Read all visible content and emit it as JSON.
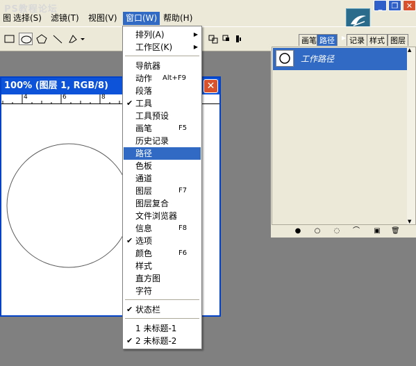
{
  "watermark": "PS教程论坛",
  "menubar": {
    "items": [
      {
        "label": "窗口(W)",
        "active": true
      },
      {
        "label": "帮助(H)",
        "active": false
      },
      {
        "label": "视图(V)",
        "active": false
      },
      {
        "label": "滤镜(T)",
        "active": false
      },
      {
        "label": "选择(S)",
        "active": false
      },
      {
        "label": "图"
      }
    ]
  },
  "document": {
    "title": "100% (图层 1, RGB/8)",
    "ruler_ticks": [
      "4",
      "6",
      "8"
    ]
  },
  "window_menu": {
    "items": [
      {
        "label": "排列(A)",
        "shortcut": "",
        "checked": false,
        "submenu": true,
        "highlighted": false
      },
      {
        "label": "工作区(K)",
        "shortcut": "",
        "checked": false,
        "submenu": true,
        "highlighted": false
      },
      {
        "label": "导航器",
        "shortcut": "",
        "checked": false,
        "submenu": false,
        "highlighted": false
      },
      {
        "label": "动作",
        "shortcut": "Alt+F9",
        "checked": false,
        "submenu": false,
        "highlighted": false
      },
      {
        "label": "段落",
        "shortcut": "",
        "checked": false,
        "submenu": false,
        "highlighted": false
      },
      {
        "label": "工具",
        "shortcut": "",
        "checked": true,
        "submenu": false,
        "highlighted": false
      },
      {
        "label": "工具预设",
        "shortcut": "",
        "checked": false,
        "submenu": false,
        "highlighted": false
      },
      {
        "label": "画笔",
        "shortcut": "F5",
        "checked": false,
        "submenu": false,
        "highlighted": false
      },
      {
        "label": "历史记录",
        "shortcut": "",
        "checked": false,
        "submenu": false,
        "highlighted": false
      },
      {
        "label": "路径",
        "shortcut": "",
        "checked": false,
        "submenu": false,
        "highlighted": true
      },
      {
        "label": "色板",
        "shortcut": "",
        "checked": false,
        "submenu": false,
        "highlighted": false
      },
      {
        "label": "通道",
        "shortcut": "",
        "checked": false,
        "submenu": false,
        "highlighted": false
      },
      {
        "label": "图层",
        "shortcut": "F7",
        "checked": false,
        "submenu": false,
        "highlighted": false
      },
      {
        "label": "图层复合",
        "shortcut": "",
        "checked": false,
        "submenu": false,
        "highlighted": false
      },
      {
        "label": "文件浏览器",
        "shortcut": "",
        "checked": false,
        "submenu": false,
        "highlighted": false
      },
      {
        "label": "信息",
        "shortcut": "F8",
        "checked": false,
        "submenu": false,
        "highlighted": false
      },
      {
        "label": "选项",
        "shortcut": "",
        "checked": true,
        "submenu": false,
        "highlighted": false
      },
      {
        "label": "颜色",
        "shortcut": "F6",
        "checked": false,
        "submenu": false,
        "highlighted": false
      },
      {
        "label": "样式",
        "shortcut": "",
        "checked": false,
        "submenu": false,
        "highlighted": false
      },
      {
        "label": "直方图",
        "shortcut": "",
        "checked": false,
        "submenu": false,
        "highlighted": false
      },
      {
        "label": "字符",
        "shortcut": "",
        "checked": false,
        "submenu": false,
        "highlighted": false
      },
      {
        "label": "状态栏",
        "shortcut": "",
        "checked": true,
        "submenu": false,
        "highlighted": false
      },
      {
        "label": "1 未标题-1",
        "shortcut": "",
        "checked": false,
        "submenu": false,
        "highlighted": false
      },
      {
        "label": "2 未标题-2",
        "shortcut": "",
        "checked": true,
        "submenu": false,
        "highlighted": false
      }
    ]
  },
  "paths_palette": {
    "tabs": [
      "画笔",
      "路径",
      "记录",
      "样式",
      "图层"
    ],
    "active_tab": "路径",
    "rows": [
      {
        "name": "工作路径"
      }
    ],
    "colors": {
      "selection": "#316ac5"
    }
  }
}
